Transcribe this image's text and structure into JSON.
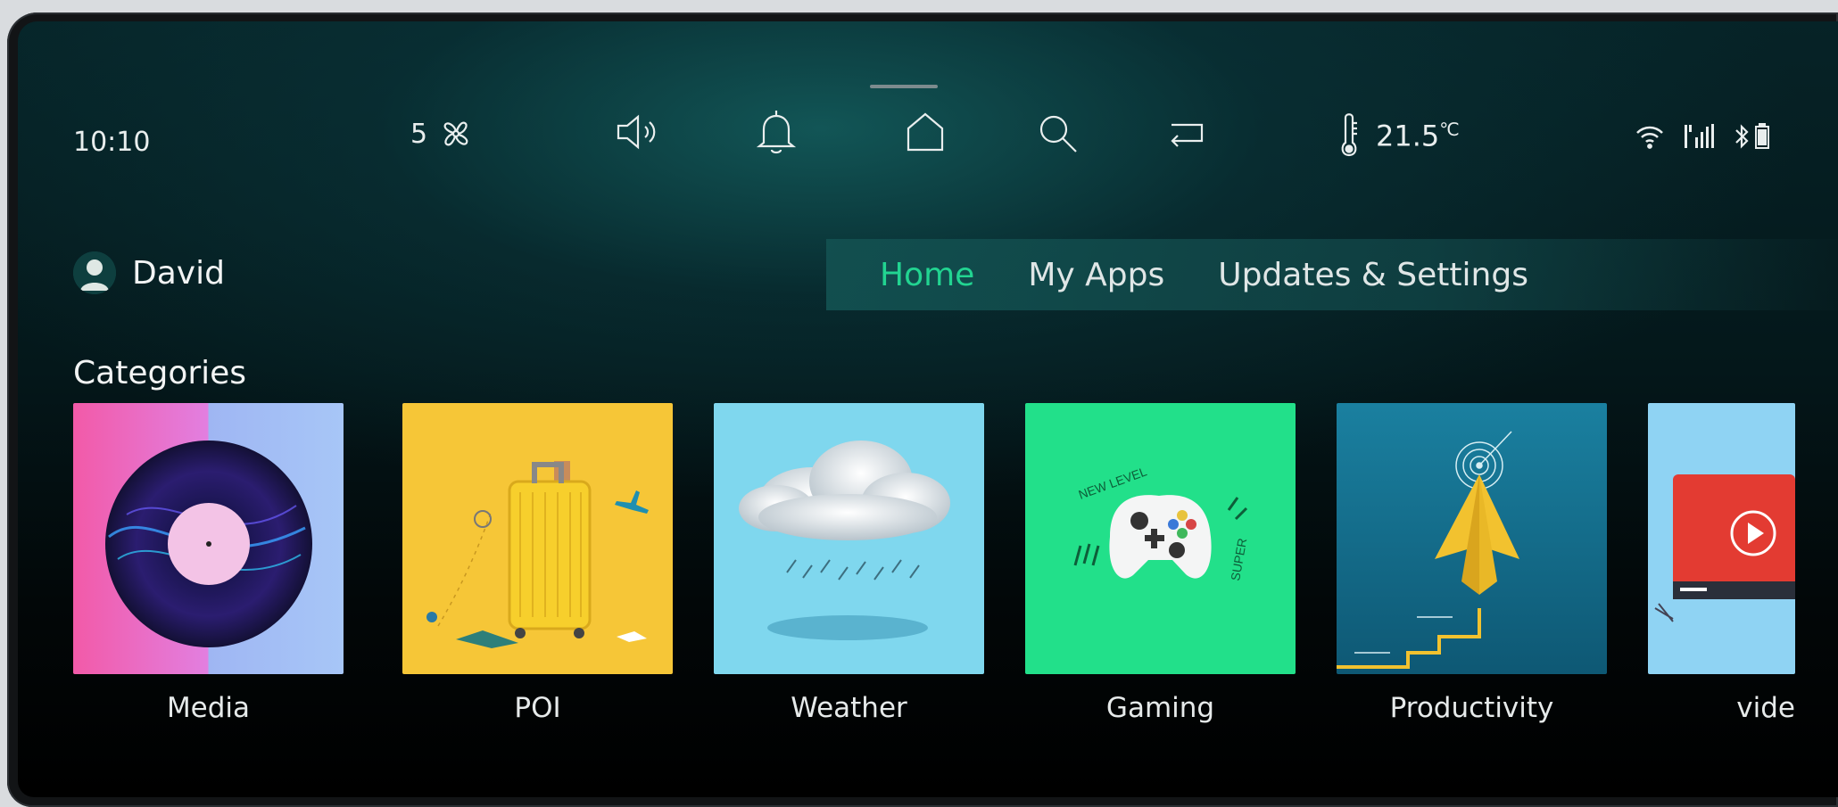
{
  "status_bar": {
    "time": "10:10",
    "fan_speed": "5",
    "temperature": "21.5",
    "temperature_unit": "℃",
    "icons": [
      "fan-icon",
      "volume-icon",
      "bell-icon",
      "home-icon",
      "search-icon",
      "return-icon",
      "thermometer-icon",
      "wifi-icon",
      "signal-icon",
      "bluetooth-icon",
      "battery-icon"
    ]
  },
  "user": {
    "name": "David"
  },
  "nav": {
    "tabs": [
      {
        "label": "Home",
        "active": true
      },
      {
        "label": "My Apps",
        "active": false
      },
      {
        "label": "Updates & Settings",
        "active": false
      }
    ]
  },
  "categories": {
    "title": "Categories",
    "items": [
      {
        "label": "Media",
        "art": "vinyl-record"
      },
      {
        "label": "POI",
        "art": "yellow-suitcase"
      },
      {
        "label": "Weather",
        "art": "rain-cloud"
      },
      {
        "label": "Gaming",
        "art": "game-controller",
        "art_text_1": "NEW LEVEL",
        "art_text_2": "SUPER"
      },
      {
        "label": "Productivity",
        "art": "paper-plane-target"
      },
      {
        "label": "vide",
        "art": "video-player"
      }
    ]
  },
  "colors": {
    "accent": "#22d491",
    "background": "#04171a",
    "text": "#e9eeee"
  }
}
